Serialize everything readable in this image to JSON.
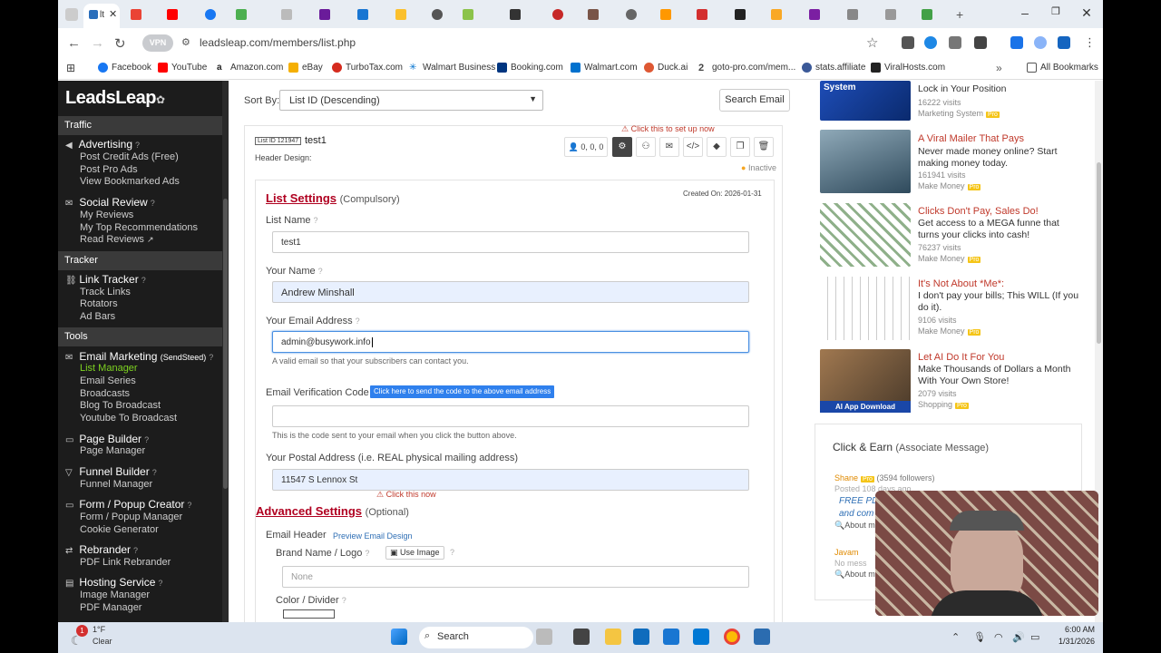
{
  "browser": {
    "active_tab_label": "lt",
    "url": "leadsleap.com/members/list.php",
    "vpn_label": "VPN",
    "new_tab": "+",
    "window_controls": [
      "–",
      "❐",
      "✕"
    ]
  },
  "bookmarks": [
    {
      "label": "Facebook",
      "color": "#1877f2"
    },
    {
      "label": "YouTube",
      "color": "#ff0000"
    },
    {
      "label": "Amazon.com",
      "color": "#222222"
    },
    {
      "label": "eBay",
      "color": "#e53238"
    },
    {
      "label": "TurboTax.com",
      "color": "#d52b1e"
    },
    {
      "label": "Walmart Business",
      "color": "#0071ce"
    },
    {
      "label": "Booking.com",
      "color": "#003580"
    },
    {
      "label": "Walmart.com",
      "color": "#0071ce"
    },
    {
      "label": "Duck.ai",
      "color": "#de5833"
    },
    {
      "label": "goto-pro.com/mem...",
      "color": "#444444"
    },
    {
      "label": "stats.affiliate",
      "color": "#3b5998"
    },
    {
      "label": "ViralHosts.com",
      "color": "#222222"
    }
  ],
  "all_bookmarks": "All Bookmarks",
  "sidebar": {
    "logo": "LeadsLeap",
    "sections": {
      "traffic": "Traffic",
      "tracker": "Tracker",
      "tools": "Tools"
    },
    "advertising": {
      "title": "Advertising",
      "items": [
        "Post Credit Ads (Free)",
        "Post Pro Ads",
        "View Bookmarked Ads"
      ]
    },
    "social": {
      "title": "Social Review",
      "items": [
        "My Reviews",
        "My Top Recommendations",
        "Read Reviews"
      ]
    },
    "link_tracker": {
      "title": "Link Tracker",
      "items": [
        "Track Links",
        "Rotators",
        "Ad Bars"
      ]
    },
    "email_marketing": {
      "title": "Email Marketing",
      "tag": "(SendSteed)",
      "items": [
        "List Manager",
        "Email Series",
        "Broadcasts",
        "Blog To Broadcast",
        "Youtube To Broadcast"
      ]
    },
    "page_builder": {
      "title": "Page Builder",
      "items": [
        "Page Manager"
      ]
    },
    "funnel_builder": {
      "title": "Funnel Builder",
      "items": [
        "Funnel Manager"
      ]
    },
    "form_popup": {
      "title": "Form / Popup Creator",
      "items": [
        "Form / Popup Manager",
        "Cookie Generator"
      ]
    },
    "rebrander": {
      "title": "Rebrander",
      "items": [
        "PDF Link Rebrander"
      ]
    },
    "hosting": {
      "title": "Hosting Service",
      "items": [
        "Image Manager",
        "PDF Manager"
      ]
    }
  },
  "main": {
    "sort_by_label": "Sort By:",
    "sort_by_value": "List ID (Descending)",
    "search_email": "Search Email",
    "list_id": "List ID 121947",
    "list_name": "test1",
    "header_design": "Header Design:",
    "setup_link": "Click this to set up now",
    "stats": "0, 0, 0",
    "status": "Inactive",
    "created": "Created On: 2026-01-31",
    "list_settings": "List Settings",
    "compulsory": "(Compulsory)",
    "list_name_label": "List Name",
    "list_name_value": "test1",
    "your_name_label": "Your Name",
    "your_name_value": "Andrew Minshall",
    "email_label": "Your Email Address",
    "email_value": "admin@busywork.info",
    "email_hint": "A valid email so that your subscribers can contact you.",
    "click_now": "Click this now",
    "verification_label": "Email Verification Code",
    "send_code": "Click here to send the code to the above email address",
    "verification_hint": "This is the code sent to your email when you click the button above.",
    "postal_label": "Your Postal Address (i.e. REAL physical mailing address)",
    "postal_value": "11547 S Lennox St",
    "advanced_settings": "Advanced Settings",
    "optional": "(Optional)",
    "email_header": "Email Header",
    "preview_email": "Preview Email Design",
    "brand_label": "Brand Name / Logo",
    "use_image": "Use Image",
    "brand_placeholder": "None",
    "color_divider": "Color / Divider"
  },
  "right": {
    "ads": [
      {
        "title": "",
        "text": "Lock in Your Position",
        "visits": "16222 visits",
        "category": "Marketing System",
        "img_color": "#1e4db7"
      },
      {
        "title": "A Viral Mailer That Pays",
        "text": "Never made money online? Start making money today.",
        "visits": "161941 visits",
        "category": "Make Money",
        "img_color": "#3f6a8a"
      },
      {
        "title": "Clicks Don't Pay, Sales Do!",
        "text": "Get access to a MEGA funne that turns your clicks into cash!",
        "visits": "76237 visits",
        "category": "Make Money",
        "img_color": "#6f8f6a"
      },
      {
        "title": "It's Not About *Me*:",
        "text": "I don't pay your bills; This WILL (If you do it).",
        "visits": "9106 visits",
        "category": "Make Money",
        "img_color": "#d9d9d9"
      },
      {
        "title": "Let AI Do It For You",
        "text": "Make Thousands of Dollars a Month With Your Own Store!",
        "visits": "2079 visits",
        "category": "Shopping",
        "img_color": "#7a5a3a"
      }
    ],
    "pro": "Pro",
    "ai_badge": "AI App Download",
    "click_earn": "Click & Earn",
    "associate": "(Associate Message)",
    "shane": "Shane",
    "shane_followers": "(3594 followers)",
    "posted": "Posted 108 days ago",
    "free_pd": "FREE PD",
    "and_com": "and com",
    "about": "About m",
    "javam": "Javam",
    "no_mess": "No mess"
  },
  "taskbar": {
    "temp": "1°F",
    "weather": "Clear",
    "search": "Search",
    "time": "6:00 AM",
    "date": "1/31/2026",
    "notif": "1"
  }
}
